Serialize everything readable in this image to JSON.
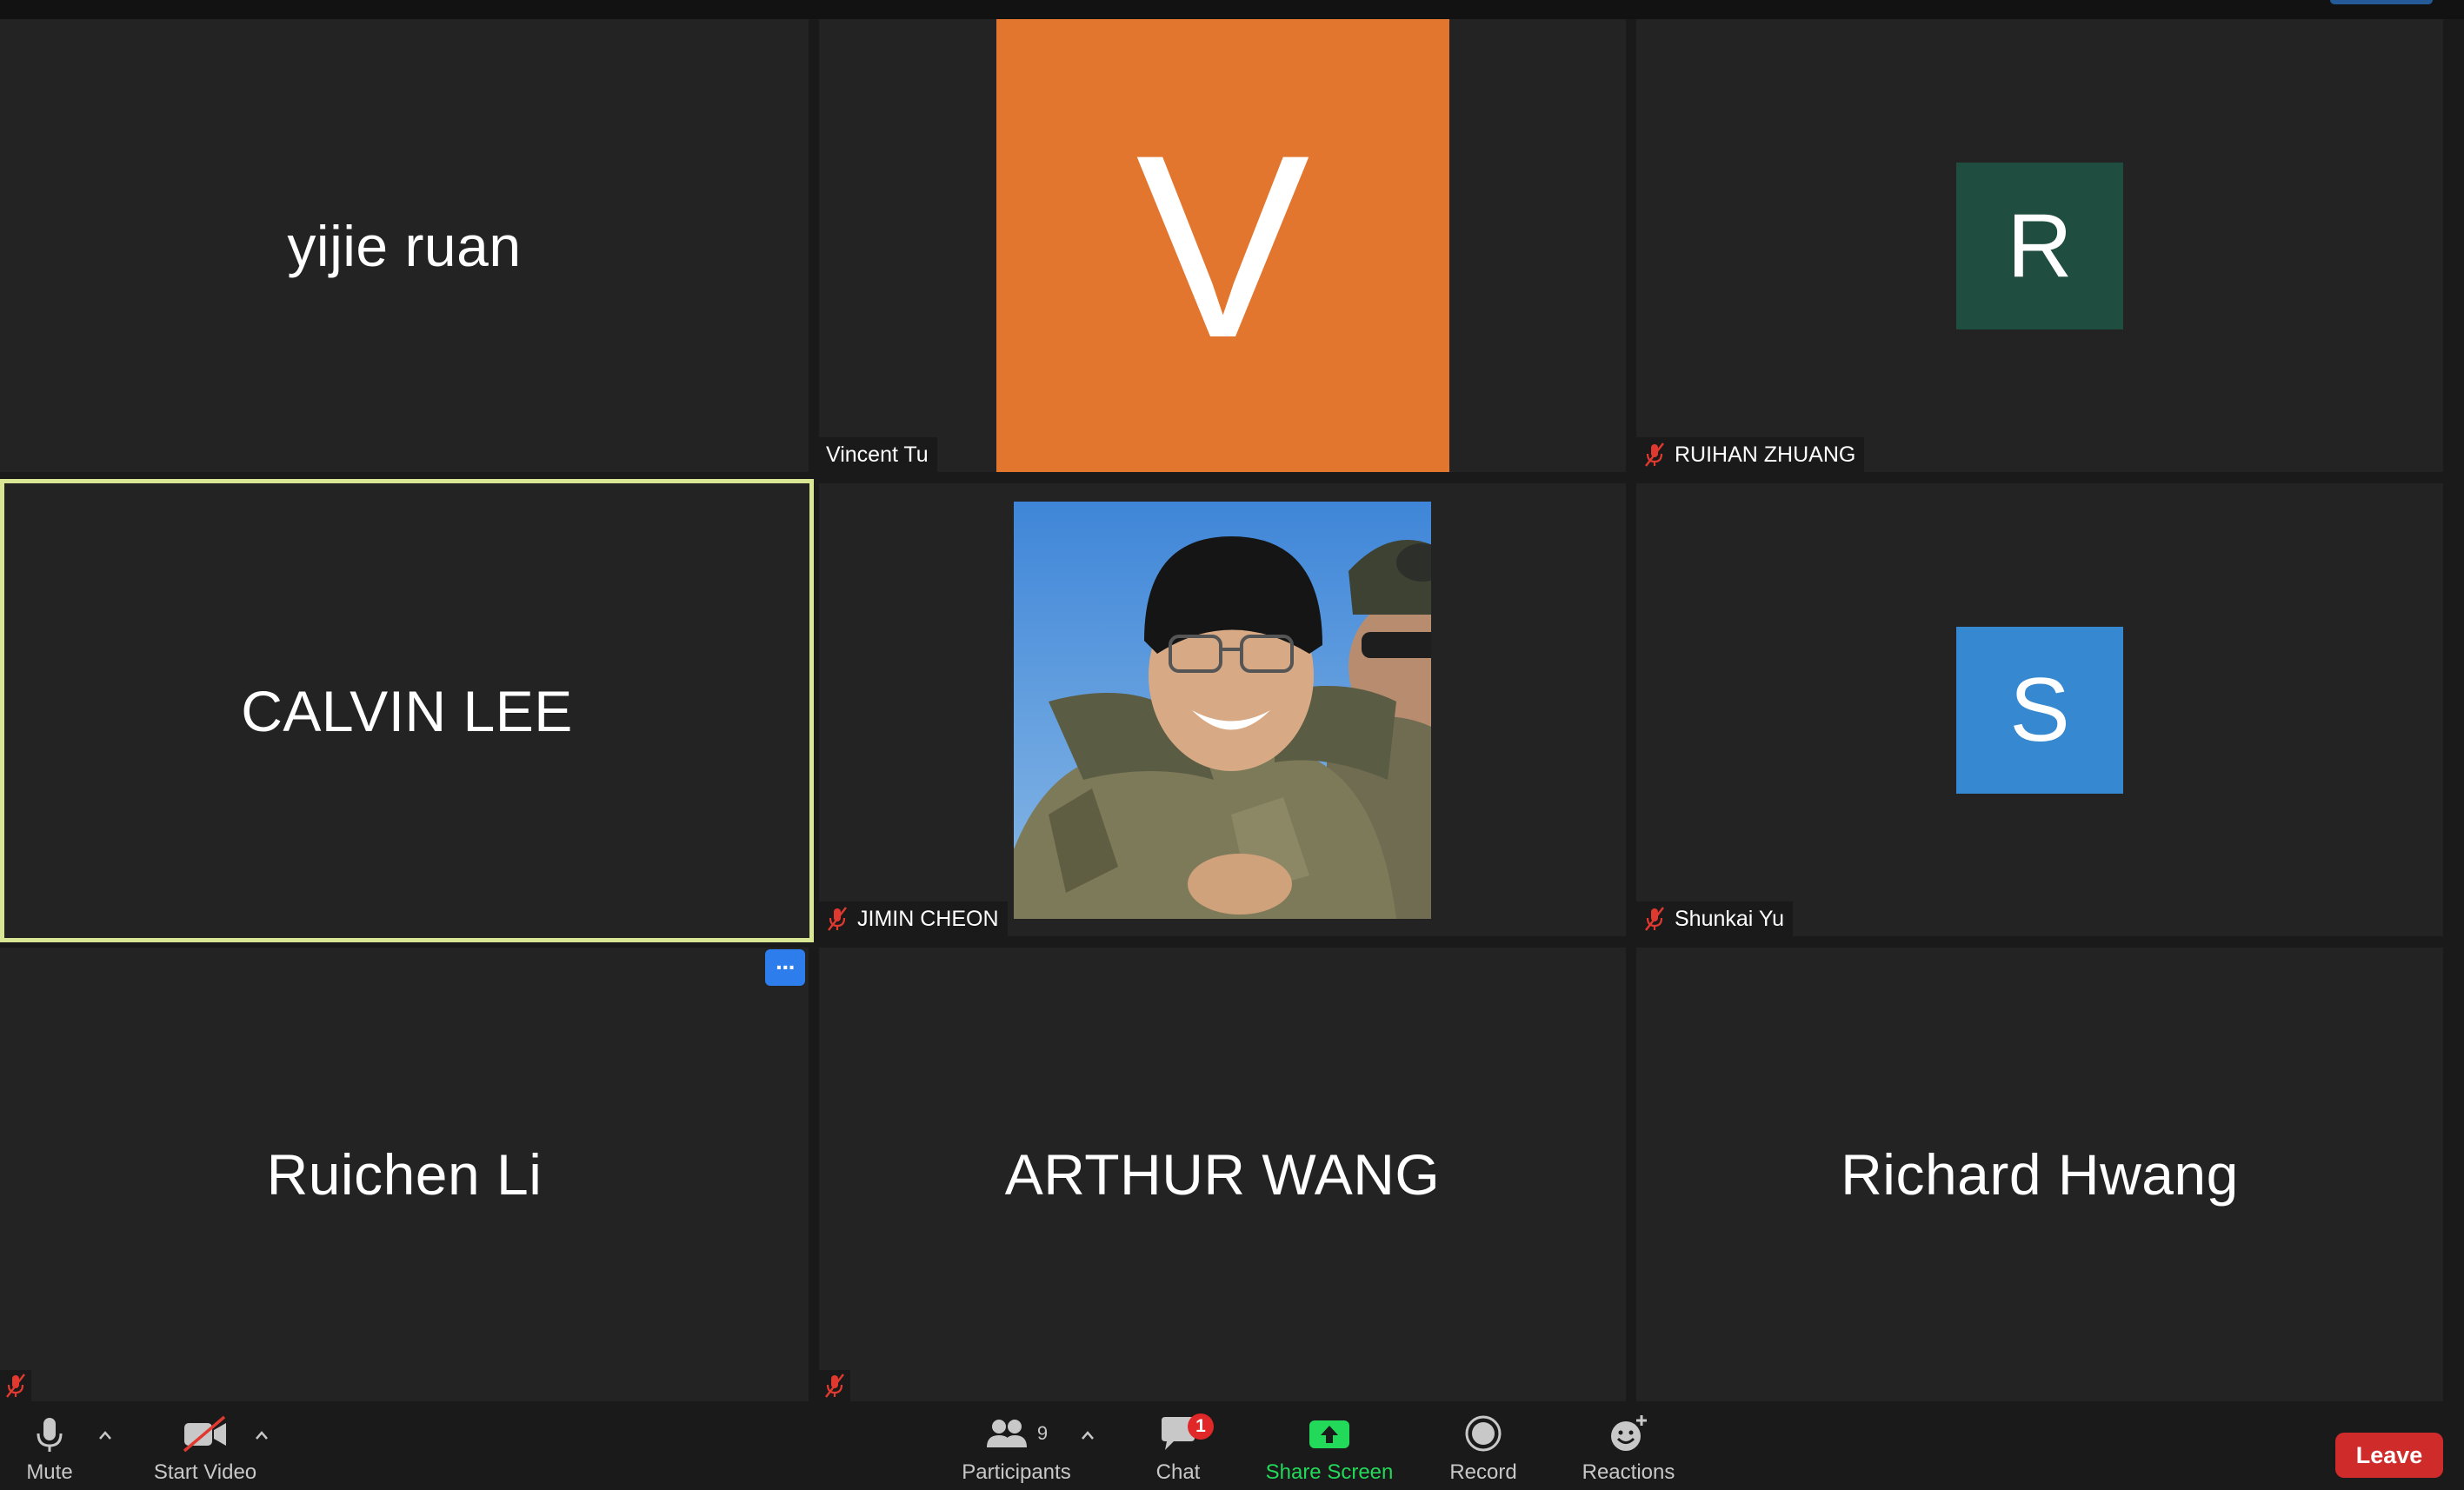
{
  "meeting": {
    "tiles": [
      {
        "name": "yijie ruan",
        "display": "name-only",
        "muted": false
      },
      {
        "name": "Vincent Tu",
        "display": "avatar",
        "avatar_letter": "V",
        "avatar_color": "#e2762f",
        "muted": false
      },
      {
        "name": "RUIHAN ZHUANG",
        "display": "avatar",
        "avatar_letter": "R",
        "avatar_color": "#1f4d3f",
        "muted": true
      },
      {
        "name": "CALVIN LEE",
        "display": "name-only",
        "muted": false,
        "active_speaker": true
      },
      {
        "name": "JIMIN CHEON",
        "display": "photo",
        "muted": true
      },
      {
        "name": "Shunkai Yu",
        "display": "avatar",
        "avatar_letter": "S",
        "avatar_color": "#3688d0",
        "muted": true
      },
      {
        "name": "Ruichen Li",
        "display": "name-only",
        "muted": true,
        "more_button": "···"
      },
      {
        "name": "ARTHUR WANG",
        "display": "name-only",
        "muted": true
      },
      {
        "name": "Richard Hwang",
        "display": "name-only",
        "muted": false
      }
    ]
  },
  "toolbar": {
    "mute_label": "Mute",
    "video_label": "Start Video",
    "participants_label": "Participants",
    "participants_count": "9",
    "chat_label": "Chat",
    "chat_badge": "1",
    "share_label": "Share Screen",
    "record_label": "Record",
    "reactions_label": "Reactions",
    "leave_label": "Leave"
  },
  "colors": {
    "active_speaker_border": "#d9e794",
    "share_green": "#23d959",
    "leave_red": "#cf2b2b",
    "more_blue": "#2d7ded",
    "muted_red": "#e0392f"
  },
  "icons": {
    "mute": "microphone-icon",
    "video": "video-off-icon",
    "participants": "participants-icon",
    "chat": "chat-icon",
    "share": "share-screen-icon",
    "record": "record-icon",
    "reactions": "reactions-icon",
    "muted": "mic-muted-icon"
  }
}
